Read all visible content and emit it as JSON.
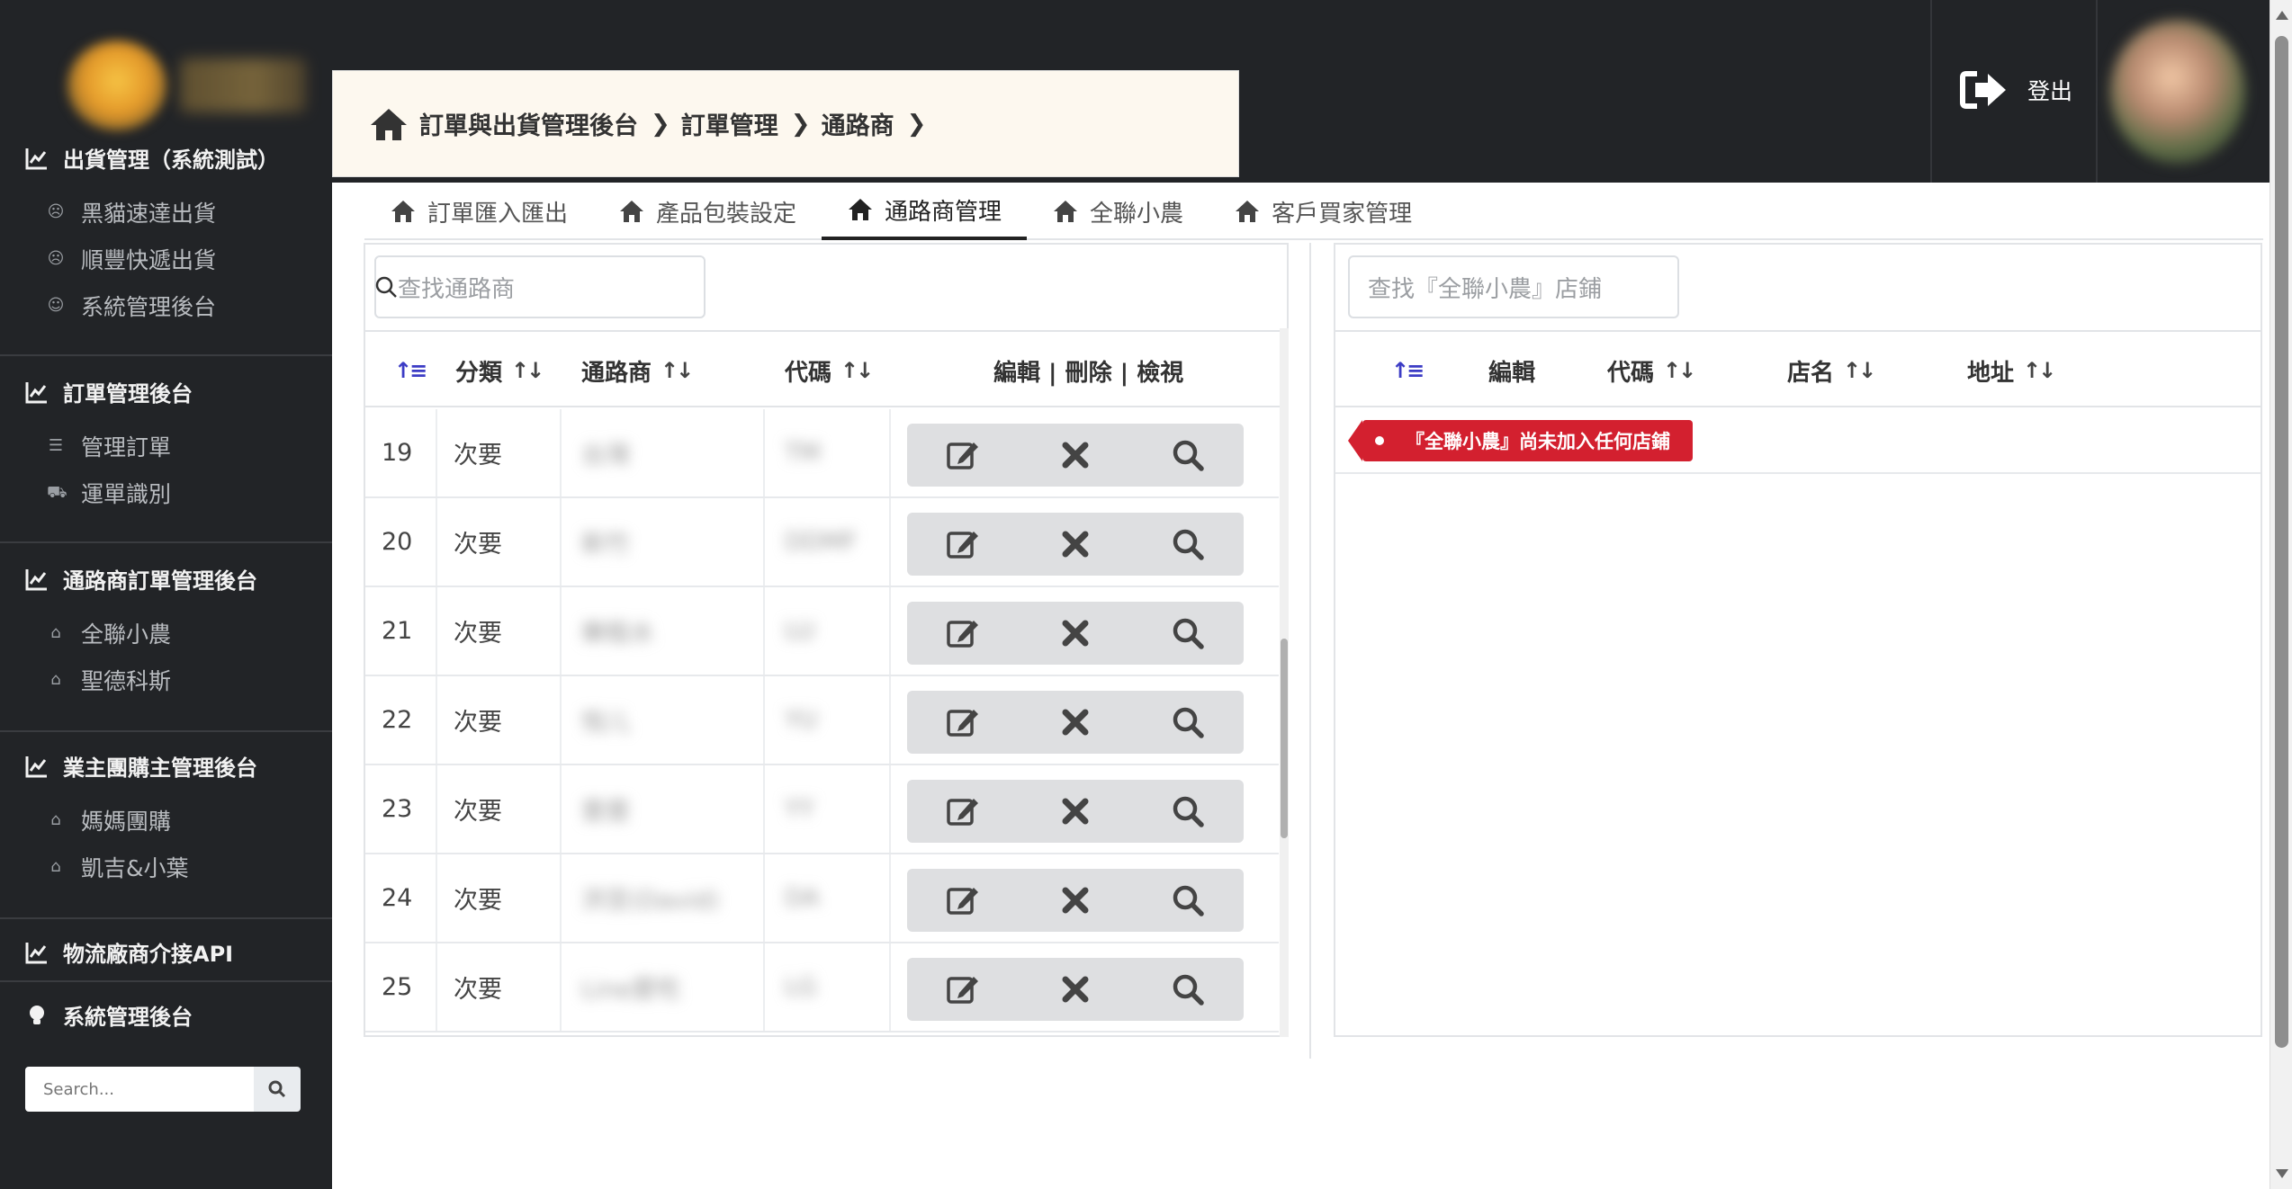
{
  "sidebar": {
    "sections": [
      {
        "title": "出貨管理（系統測試）",
        "items": [
          {
            "label": "黑貓速達出貨",
            "icon": "user-secret-icon"
          },
          {
            "label": "順豐快遞出貨",
            "icon": "user-secret-icon"
          },
          {
            "label": "系統管理後台",
            "icon": "users-icon"
          }
        ]
      },
      {
        "title": "訂單管理後台",
        "items": [
          {
            "label": "管理訂單",
            "icon": "list-icon"
          },
          {
            "label": "運單識別",
            "icon": "car-icon"
          }
        ]
      },
      {
        "title": "通路商訂單管理後台",
        "items": [
          {
            "label": "全聯小農",
            "icon": "home-icon"
          },
          {
            "label": "聖德科斯",
            "icon": "home-icon"
          }
        ]
      },
      {
        "title": "業主團購主管理後台",
        "items": [
          {
            "label": "媽媽團購",
            "icon": "home-icon"
          },
          {
            "label": "凱吉&小葉",
            "icon": "home-icon"
          }
        ]
      },
      {
        "title": "物流廠商介接API",
        "items": []
      },
      {
        "title": "系統管理後台",
        "items": []
      }
    ],
    "search_placeholder": "Search..."
  },
  "topbar": {
    "logout_label": "登出"
  },
  "breadcrumb": [
    "訂單與出貨管理後台",
    "訂單管理",
    "通路商"
  ],
  "tabs": [
    {
      "label": "訂單匯入匯出",
      "active": false
    },
    {
      "label": "產品包裝設定",
      "active": false
    },
    {
      "label": "通路商管理",
      "active": true
    },
    {
      "label": "全聯小農",
      "active": false
    },
    {
      "label": "客戶買家管理",
      "active": false
    }
  ],
  "left_table": {
    "search_placeholder": "查找通路商",
    "headers": {
      "category": "分類",
      "vendor": "通路商",
      "code": "代碼",
      "actions": "編輯 | 刪除 | 檢視"
    },
    "rows": [
      {
        "no": "19",
        "category": "次要",
        "vendor": "台灣",
        "code": "TM"
      },
      {
        "no": "20",
        "category": "次要",
        "vendor": "新竹",
        "code": "DDMF"
      },
      {
        "no": "21",
        "category": "次要",
        "vendor": "樂租水",
        "code": "LU"
      },
      {
        "no": "22",
        "category": "次要",
        "vendor": "悅儿",
        "code": "YU"
      },
      {
        "no": "23",
        "category": "次要",
        "vendor": "壹壹",
        "code": "YY"
      },
      {
        "no": "24",
        "category": "次要",
        "vendor": "洪至(David)",
        "code": "DA"
      },
      {
        "no": "25",
        "category": "次要",
        "vendor": "Line愛吃",
        "code": "LG"
      }
    ]
  },
  "right_table": {
    "search_placeholder": "查找『全聯小農』店鋪",
    "headers": {
      "edit": "編輯",
      "code": "代碼",
      "store_name": "店名",
      "address": "地址"
    },
    "empty_message": "『全聯小農』尚未加入任何店鋪"
  },
  "colors": {
    "sidebar_bg": "#222427",
    "breadcrumb_bg": "#fdf8ef",
    "badge_red": "#d3202f",
    "sort_active": "#3c3cc5"
  }
}
